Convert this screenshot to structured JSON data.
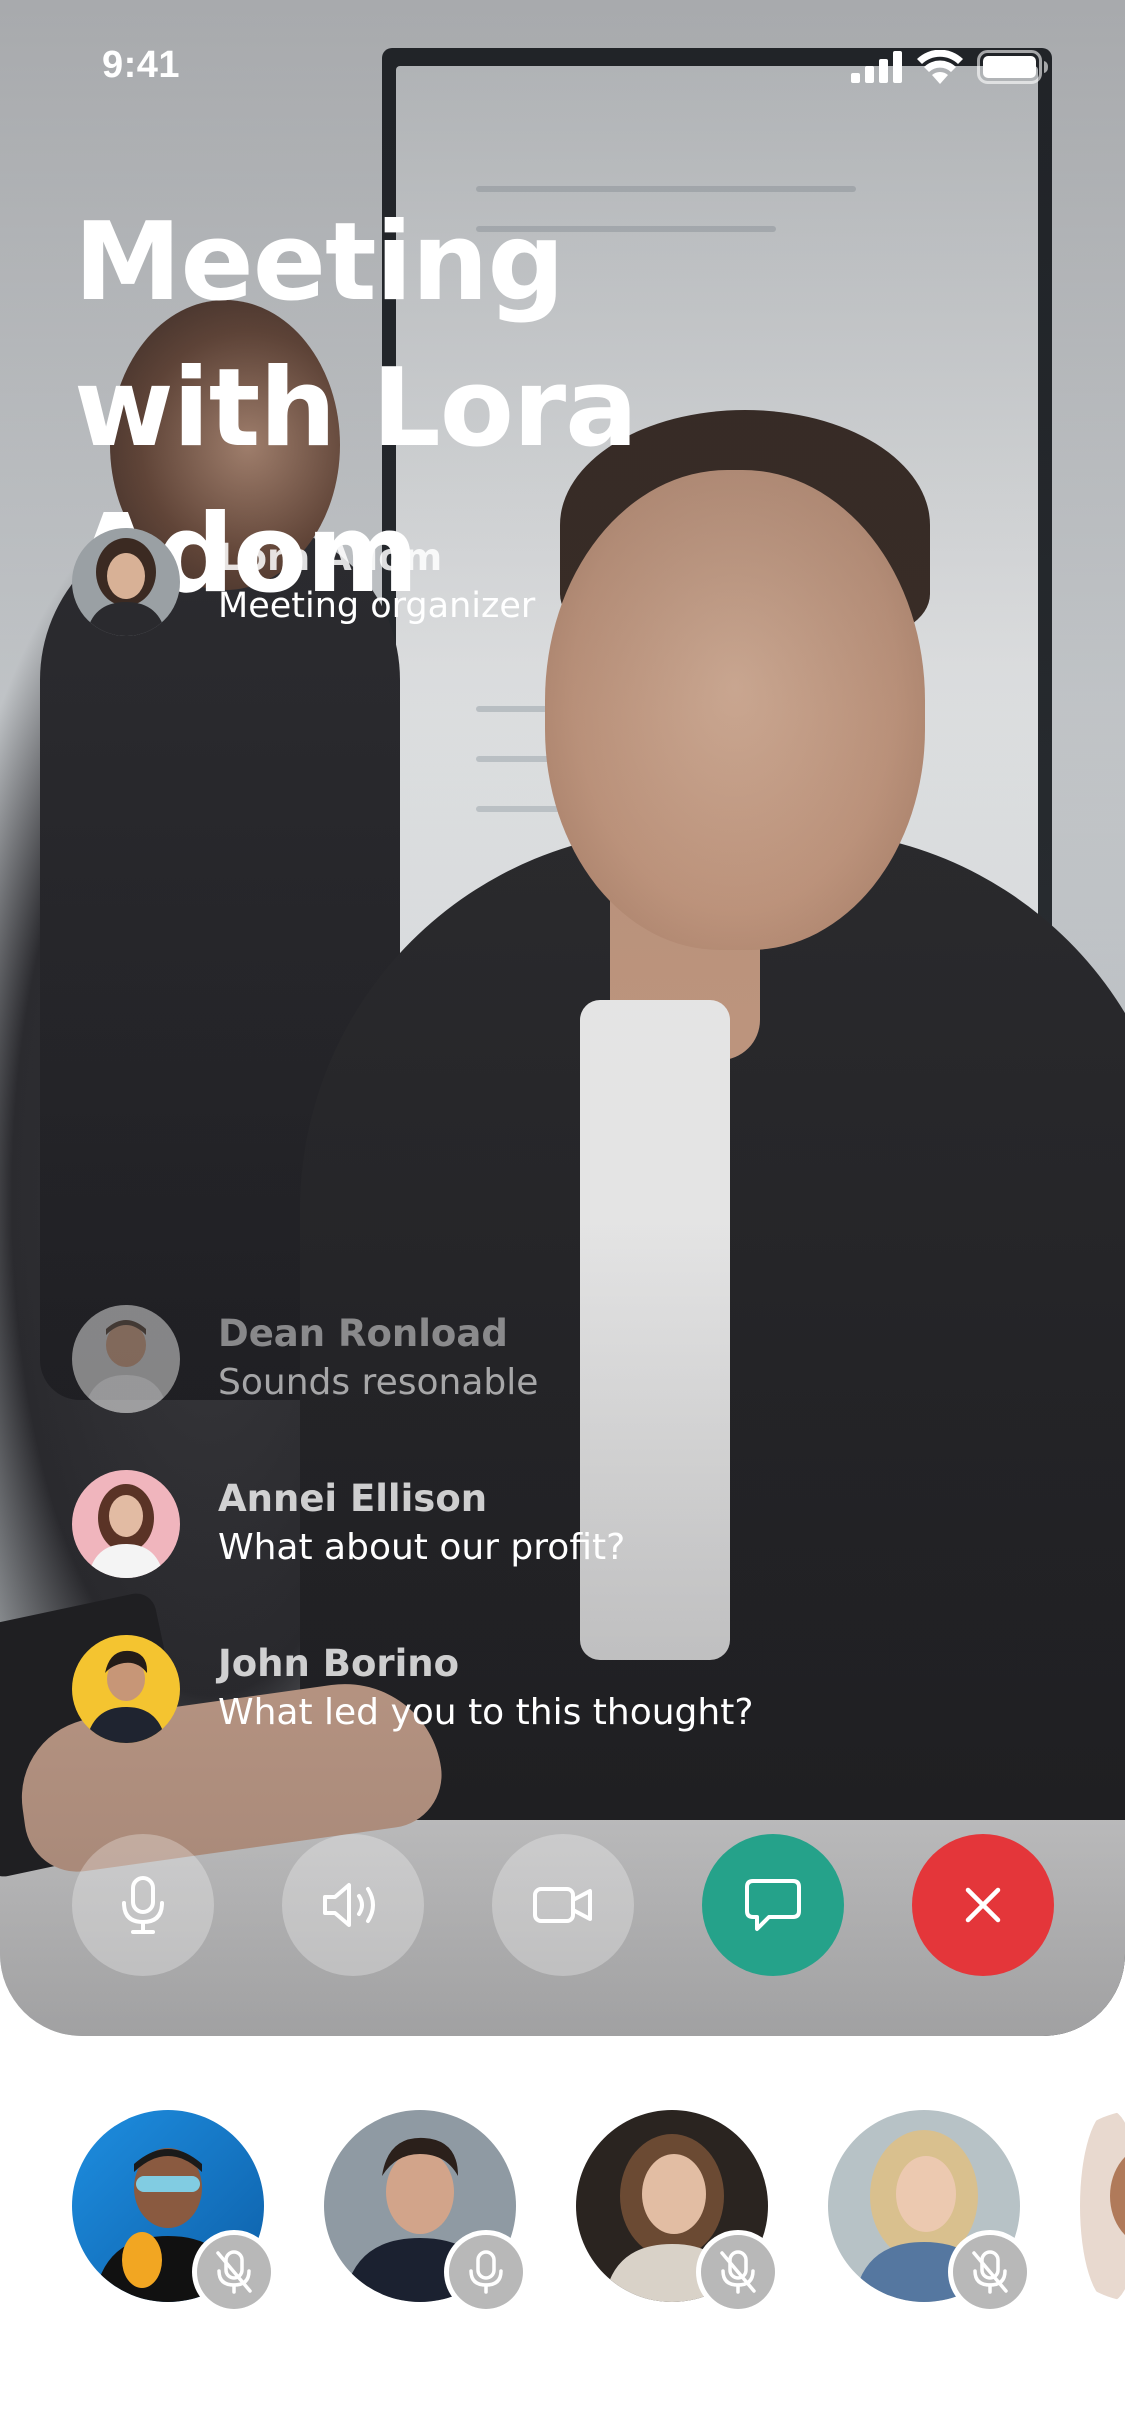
{
  "status_bar": {
    "time": "9:41",
    "icons": [
      "signal-icon",
      "wifi-icon",
      "battery-icon"
    ]
  },
  "meeting": {
    "title": "Meeting with Lora Adom",
    "organizer": {
      "name": "Lora Adom",
      "role": "Meeting organizer"
    }
  },
  "chat": [
    {
      "name": "Dean Ronload",
      "message": "Sounds resonable"
    },
    {
      "name": "Annei Ellison",
      "message": "What about our profit?"
    },
    {
      "name": "John Borino",
      "message": "What led you to this thought?"
    }
  ],
  "controls": [
    {
      "name": "microphone",
      "icon": "microphone-icon"
    },
    {
      "name": "speaker",
      "icon": "speaker-icon"
    },
    {
      "name": "camera",
      "icon": "video-camera-icon"
    },
    {
      "name": "chat",
      "icon": "chat-bubble-icon",
      "color": "#25a28a"
    },
    {
      "name": "end-call",
      "icon": "close-icon",
      "color": "#e4363a"
    }
  ],
  "participants": [
    {
      "mic": "muted"
    },
    {
      "mic": "on"
    },
    {
      "mic": "muted"
    },
    {
      "mic": "muted"
    }
  ],
  "colors": {
    "accent_green": "#25a28a",
    "end_red": "#e4363a"
  }
}
